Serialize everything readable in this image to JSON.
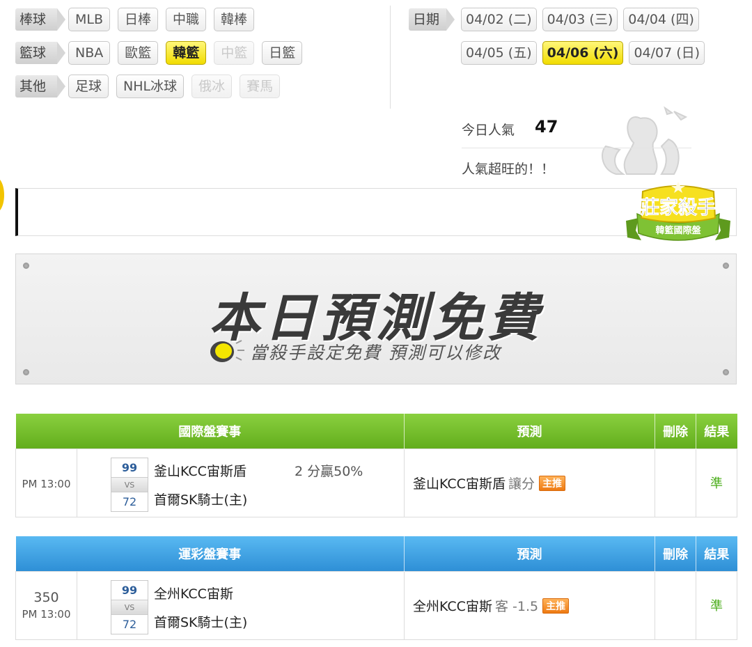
{
  "filters": {
    "rows": [
      {
        "category": "棒球",
        "items": [
          {
            "label": "MLB",
            "state": "normal"
          },
          {
            "label": "日棒",
            "state": "normal"
          },
          {
            "label": "中職",
            "state": "normal"
          },
          {
            "label": "韓棒",
            "state": "normal"
          }
        ]
      },
      {
        "category": "籃球",
        "items": [
          {
            "label": "NBA",
            "state": "normal"
          },
          {
            "label": "歐籃",
            "state": "normal"
          },
          {
            "label": "韓籃",
            "state": "active"
          },
          {
            "label": "中籃",
            "state": "disabled"
          },
          {
            "label": "日籃",
            "state": "normal"
          }
        ]
      },
      {
        "category": "其他",
        "items": [
          {
            "label": "足球",
            "state": "normal"
          },
          {
            "label": "NHL冰球",
            "state": "normal"
          },
          {
            "label": "俄冰",
            "state": "disabled"
          },
          {
            "label": "賽馬",
            "state": "disabled"
          }
        ]
      }
    ]
  },
  "dates": {
    "category": "日期",
    "rows": [
      [
        {
          "label": "04/02 (二)",
          "state": "normal"
        },
        {
          "label": "04/03 (三)",
          "state": "normal"
        },
        {
          "label": "04/04 (四)",
          "state": "normal"
        }
      ],
      [
        {
          "label": "04/05 (五)",
          "state": "normal"
        },
        {
          "label": "04/06 (六)",
          "state": "active"
        },
        {
          "label": "04/07 (日)",
          "state": "normal"
        }
      ]
    ]
  },
  "popularity": {
    "label": "今日人氣",
    "count": "47",
    "message": "人氣超旺的！！"
  },
  "badge": {
    "title": "莊家殺手",
    "subtitle": "韓籃國際盤"
  },
  "banner": {
    "title": "本日預測免費",
    "subtitle": "當殺手設定免費  預測可以修改"
  },
  "tables": [
    {
      "theme": "green",
      "headers": {
        "event": "國際盤賽事",
        "prediction": "預測",
        "delete": "刪除",
        "result": "結果"
      },
      "rows": [
        {
          "code": "",
          "time": "PM 13:00",
          "score_top": "99",
          "vs": "VS",
          "score_bottom": "72",
          "team_top": "釜山KCC宙斯盾",
          "team_bottom": "首爾SK騎士(主)",
          "odds": "2 分贏50%",
          "pred_team": "釜山KCC宙斯盾",
          "pred_spread": "讓分",
          "tag": "主推",
          "result": "準"
        }
      ]
    },
    {
      "theme": "blue",
      "headers": {
        "event": "運彩盤賽事",
        "prediction": "預測",
        "delete": "刪除",
        "result": "結果"
      },
      "rows": [
        {
          "code": "350",
          "time": "PM 13:00",
          "score_top": "99",
          "vs": "VS",
          "score_bottom": "72",
          "team_top": "全州KCC宙斯",
          "team_bottom": "首爾SK騎士(主)",
          "odds": "",
          "pred_team": "全州KCC宙斯",
          "pred_spread": "客 -1.5",
          "tag": "主推",
          "result": "準"
        }
      ]
    }
  ],
  "colors": {
    "active": "#f4e200",
    "green_header": "#6cb82a",
    "blue_header": "#3a9be0",
    "result": "#4cae1c",
    "tag": "#f08b22"
  }
}
